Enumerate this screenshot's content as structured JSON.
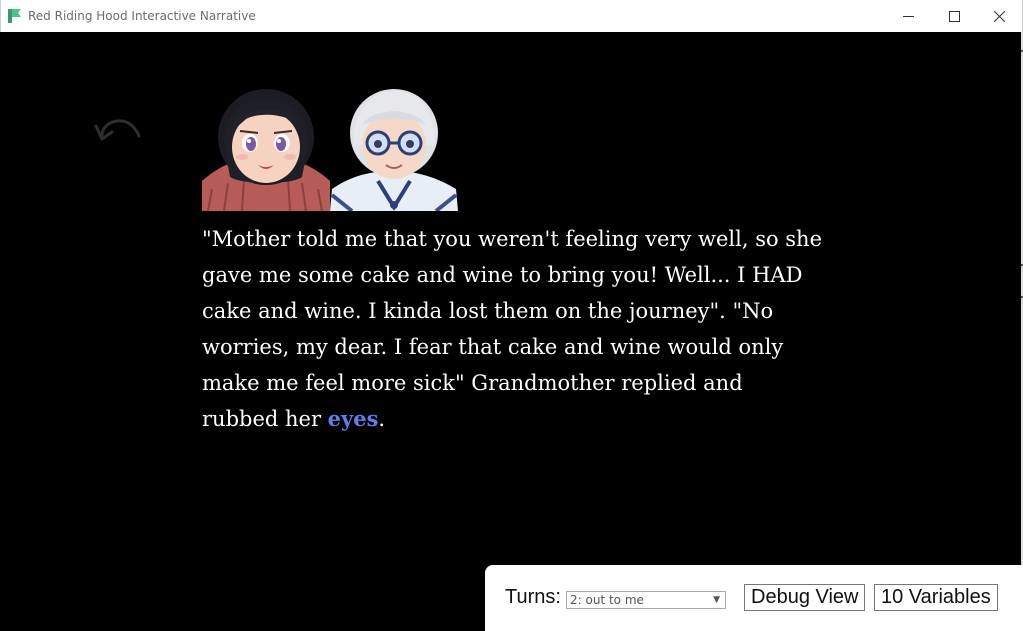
{
  "window": {
    "title": "Red Riding Hood Interactive Narrative"
  },
  "story": {
    "text_before_link": "\"Mother told me that you weren't feeling very well, so she gave me some cake and wine to bring you! Well... I HAD cake and wine. I kinda lost them on the journey\". \"No worries, my dear. I fear that cake and wine would only make me feel more sick\" Grandmother replied and rubbed her ",
    "link_text": "eyes",
    "text_after_link": ".",
    "link_color": "#5b7fe8"
  },
  "portraits": [
    "red-riding-hood-portrait",
    "grandmother-portrait"
  ],
  "controls": {
    "turns_label": "Turns:",
    "turns_selected": "2: out to me",
    "debug_button": "Debug View",
    "variables_button": "10 Variables"
  },
  "colors": {
    "background": "#000000",
    "text": "#ffffff",
    "panel": "#ffffff"
  }
}
